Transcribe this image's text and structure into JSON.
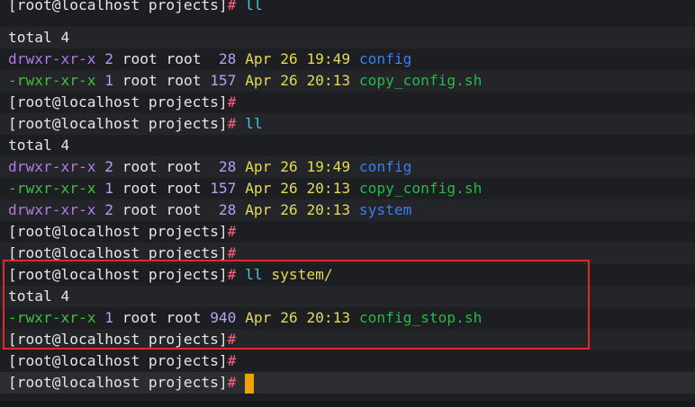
{
  "prompt": "[root@localhost projects]",
  "hash": "#",
  "lines": [
    {
      "type": "prompt",
      "cmd": "ll",
      "arg": ""
    },
    {
      "type": "text",
      "text": "total 4"
    },
    {
      "type": "entry",
      "perm": "drwxr-xr-x",
      "links": "2",
      "owner": "root",
      "group": "root",
      "size": " 28",
      "month": "Apr",
      "day": "26",
      "time": "19:49",
      "name": "config",
      "kind": "dir"
    },
    {
      "type": "entry",
      "perm": "-rwxr-xr-x",
      "links": "1",
      "owner": "root",
      "group": "root",
      "size": "157",
      "month": "Apr",
      "day": "26",
      "time": "20:13",
      "name": "copy_config.sh",
      "kind": "exe"
    },
    {
      "type": "prompt",
      "cmd": "",
      "arg": ""
    },
    {
      "type": "prompt",
      "cmd": "ll",
      "arg": ""
    },
    {
      "type": "text",
      "text": "total 4"
    },
    {
      "type": "entry",
      "perm": "drwxr-xr-x",
      "links": "2",
      "owner": "root",
      "group": "root",
      "size": " 28",
      "month": "Apr",
      "day": "26",
      "time": "19:49",
      "name": "config",
      "kind": "dir"
    },
    {
      "type": "entry",
      "perm": "-rwxr-xr-x",
      "links": "1",
      "owner": "root",
      "group": "root",
      "size": "157",
      "month": "Apr",
      "day": "26",
      "time": "20:13",
      "name": "copy_config.sh",
      "kind": "exe"
    },
    {
      "type": "entry",
      "perm": "drwxr-xr-x",
      "links": "2",
      "owner": "root",
      "group": "root",
      "size": " 28",
      "month": "Apr",
      "day": "26",
      "time": "20:13",
      "name": "system",
      "kind": "dir"
    },
    {
      "type": "prompt",
      "cmd": "",
      "arg": ""
    },
    {
      "type": "prompt",
      "cmd": "",
      "arg": ""
    },
    {
      "type": "prompt",
      "cmd": "ll",
      "arg": "system/"
    },
    {
      "type": "text",
      "text": "total 4"
    },
    {
      "type": "entry",
      "perm": "-rwxr-xr-x",
      "links": "1",
      "owner": "root",
      "group": "root",
      "size": "940",
      "month": "Apr",
      "day": "26",
      "time": "20:13",
      "name": "config_stop.sh",
      "kind": "exe"
    },
    {
      "type": "prompt",
      "cmd": "",
      "arg": ""
    },
    {
      "type": "prompt",
      "cmd": "",
      "arg": ""
    },
    {
      "type": "prompt",
      "cmd": "",
      "arg": "",
      "cursor": true
    }
  ],
  "colors": {
    "background": "#1c1e21",
    "highlight_border": "#e5262e",
    "cursor": "#f0a20a",
    "dir": "#3b7cf2",
    "exe": "#27b84a"
  }
}
